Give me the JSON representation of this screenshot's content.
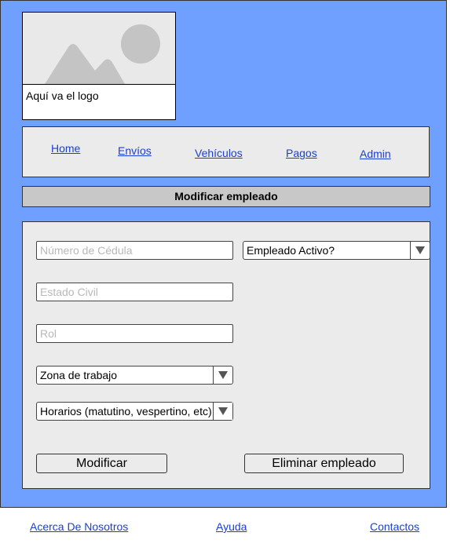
{
  "logo": {
    "caption": "Aquí va el logo",
    "icon": "image-placeholder-icon"
  },
  "nav": {
    "items": [
      "Home",
      "Envíos",
      "Vehículos",
      "Pagos",
      "Admin"
    ]
  },
  "page_title": "Modificar empleado",
  "form": {
    "cedula_placeholder": "Número de Cédula",
    "estado_civil_placeholder": "Estado Civil",
    "rol_placeholder": "Rol",
    "empleado_activo_value": "Empleado Activo?",
    "zona_trabajo_value": "Zona de trabajo",
    "horarios_value": "Horarios (matutino, vespertino, etc)",
    "modificar_label": "Modificar",
    "eliminar_label": "Eliminar empleado"
  },
  "footer": {
    "links": [
      "Acerca De Nosotros",
      "Ayuda",
      "Contactos"
    ]
  }
}
